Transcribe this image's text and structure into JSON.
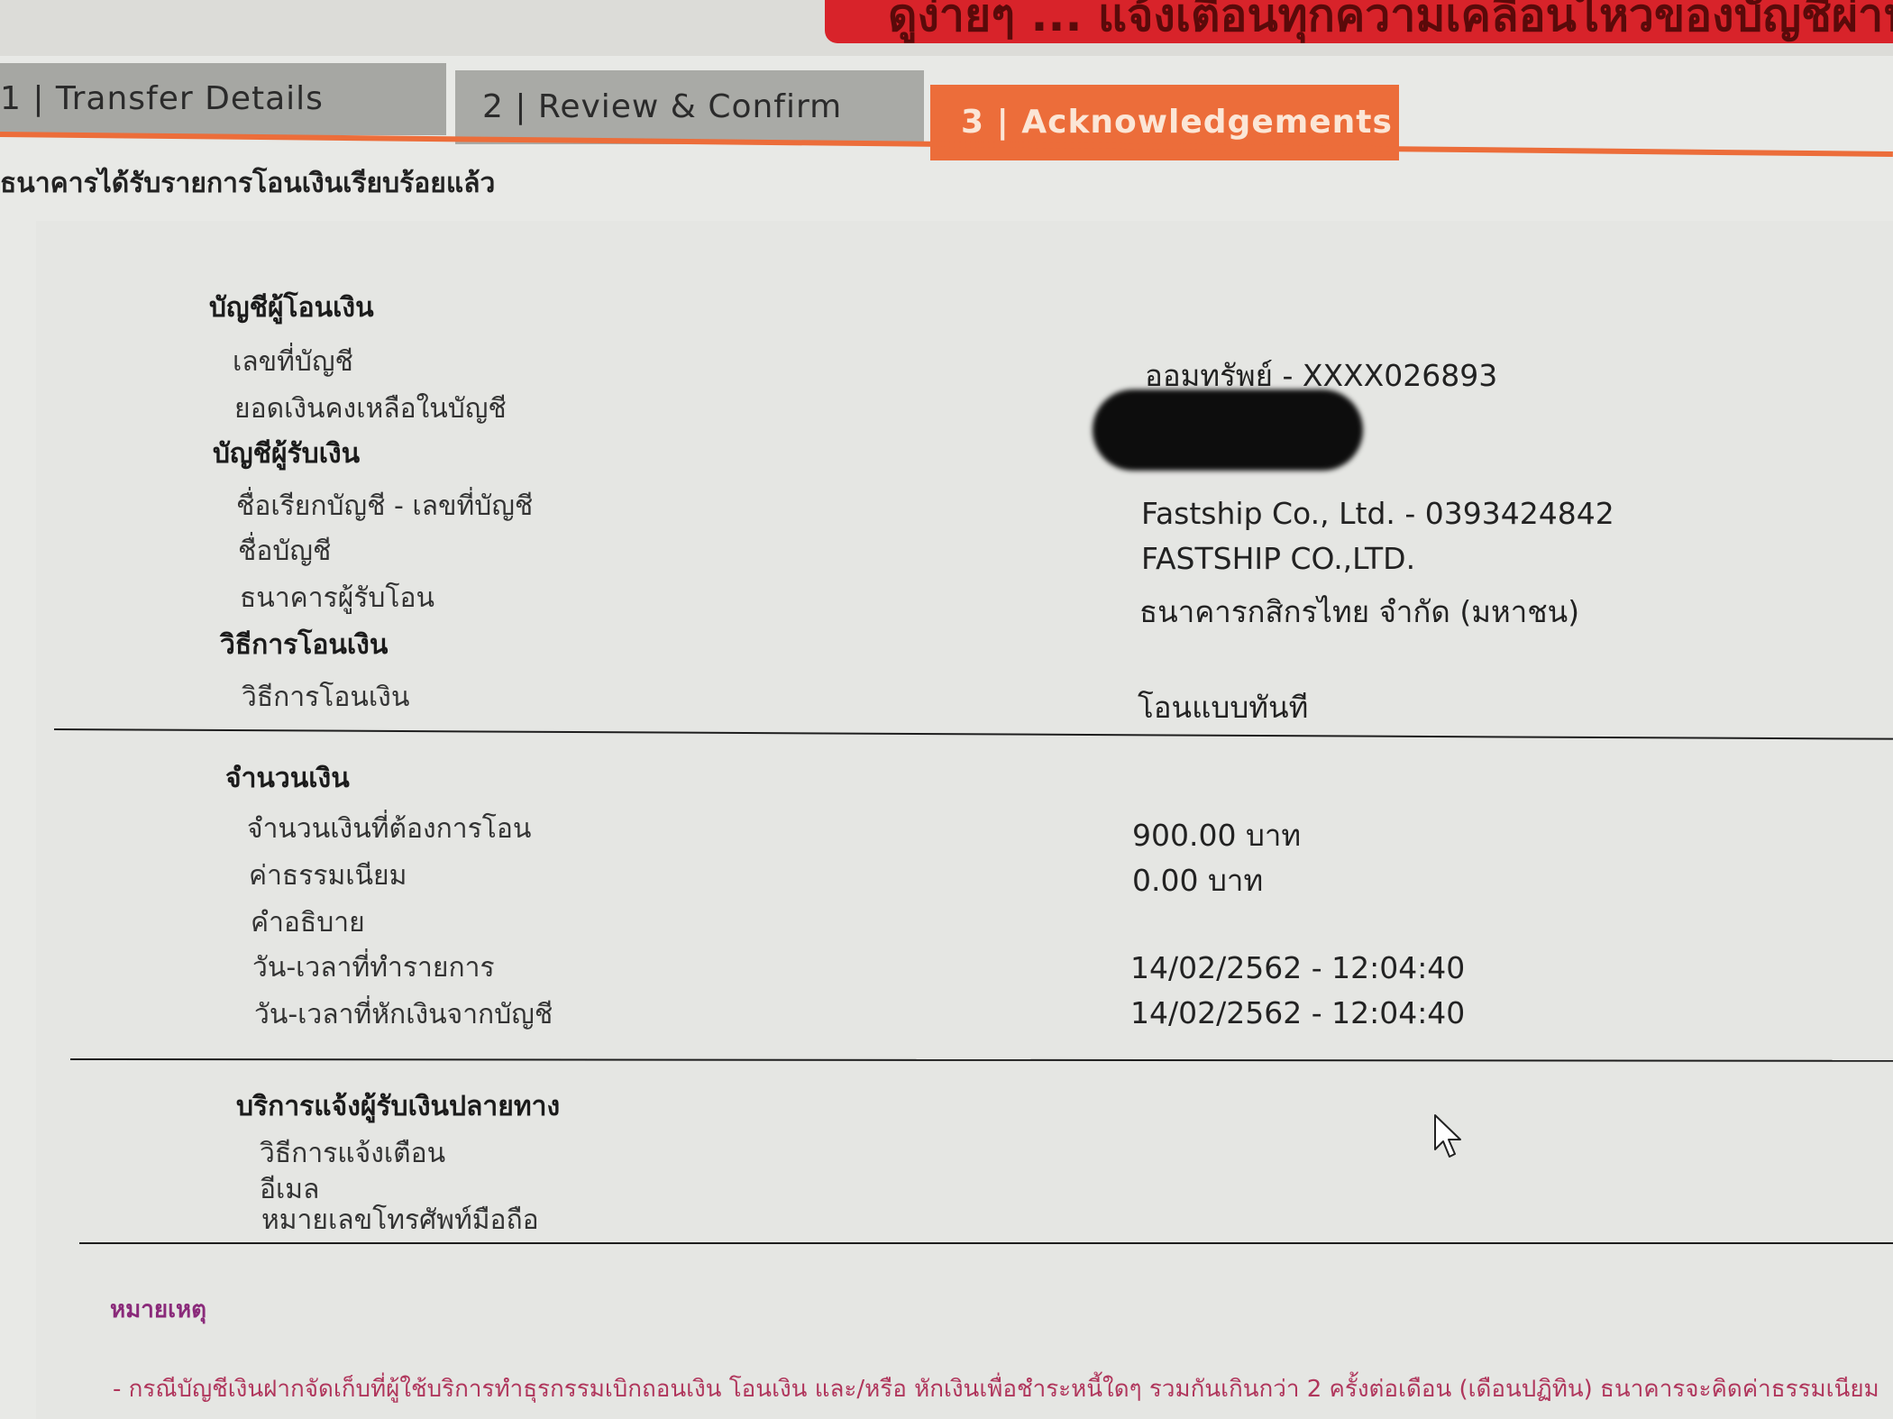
{
  "banner": {
    "text": "ดูง่ายๆ ... แจ้งเตือนทุกความเคลื่อนไหวของบัญชีผ่าน SMS"
  },
  "tabs": [
    {
      "label": "1 | Transfer Details",
      "active": false
    },
    {
      "label": "2 | Review & Confirm",
      "active": false
    },
    {
      "label": "3 | Acknowledgements",
      "active": true
    }
  ],
  "confirmation": "ธนาคารได้รับรายการโอนเงินเรียบร้อยแล้ว",
  "from_account": {
    "heading": "บัญชีผู้โอนเงิน",
    "account_no_label": "เลขที่บัญชี",
    "account_no_value": "ออมทรัพย์ - XXXX026893",
    "balance_label": "ยอดเงินคงเหลือในบัญชี"
  },
  "to_account": {
    "heading": "บัญชีผู้รับเงิน",
    "nickname_label": "ชื่อเรียกบัญชี - เลขที่บัญชี",
    "nickname_value": "Fastship Co., Ltd. - 0393424842",
    "name_label": "ชื่อบัญชี",
    "name_value": "FASTSHIP CO.,LTD.",
    "bank_label": "ธนาคารผู้รับโอน",
    "bank_value": "ธนาคารกสิกรไทย จำกัด (มหาชน)"
  },
  "method": {
    "heading": "วิธีการโอนเงิน",
    "label": "วิธีการโอนเงิน",
    "value": "โอนแบบทันที"
  },
  "amount": {
    "heading": "จำนวนเงิน",
    "amount_label": "จำนวนเงินที่ต้องการโอน",
    "amount_value": "900.00 บาท",
    "fee_label": "ค่าธรรมเนียม",
    "fee_value": "0.00  บาท",
    "description_label": "คำอธิบาย",
    "txn_time_label": "วัน-เวลาที่ทำรายการ",
    "txn_time_value": "14/02/2562 - 12:04:40",
    "debit_time_label": "วัน-เวลาที่หักเงินจากบัญชี",
    "debit_time_value": "14/02/2562 - 12:04:40"
  },
  "notify": {
    "heading": "บริการแจ้งผู้รับเงินปลายทาง",
    "method_label": "วิธีการแจ้งเตือน",
    "email_label": "อีเมล",
    "mobile_label": "หมายเลขโทรศัพท์มือถือ"
  },
  "notes": {
    "title": "หมายเหตุ",
    "text": "- กรณีบัญชีเงินฝากจัดเก็บที่ผู้ใช้บริการทำธุรกรรมเบิกถอนเงิน โอนเงิน และ/หรือ หักเงินเพื่อชำระหนี้ใดๆ รวมกันเกินกว่า 2 ครั้งต่อเดือน (เดือนปฏิทิน) ธนาคารจะคิดค่าธรรมเนียม"
  },
  "colors": {
    "active_tab": "#ec6d3a",
    "inactive_tab": "#a6a7a3",
    "banner": "#d8232a",
    "note_title": "#8a2a7a",
    "note_text": "#b0365c"
  }
}
